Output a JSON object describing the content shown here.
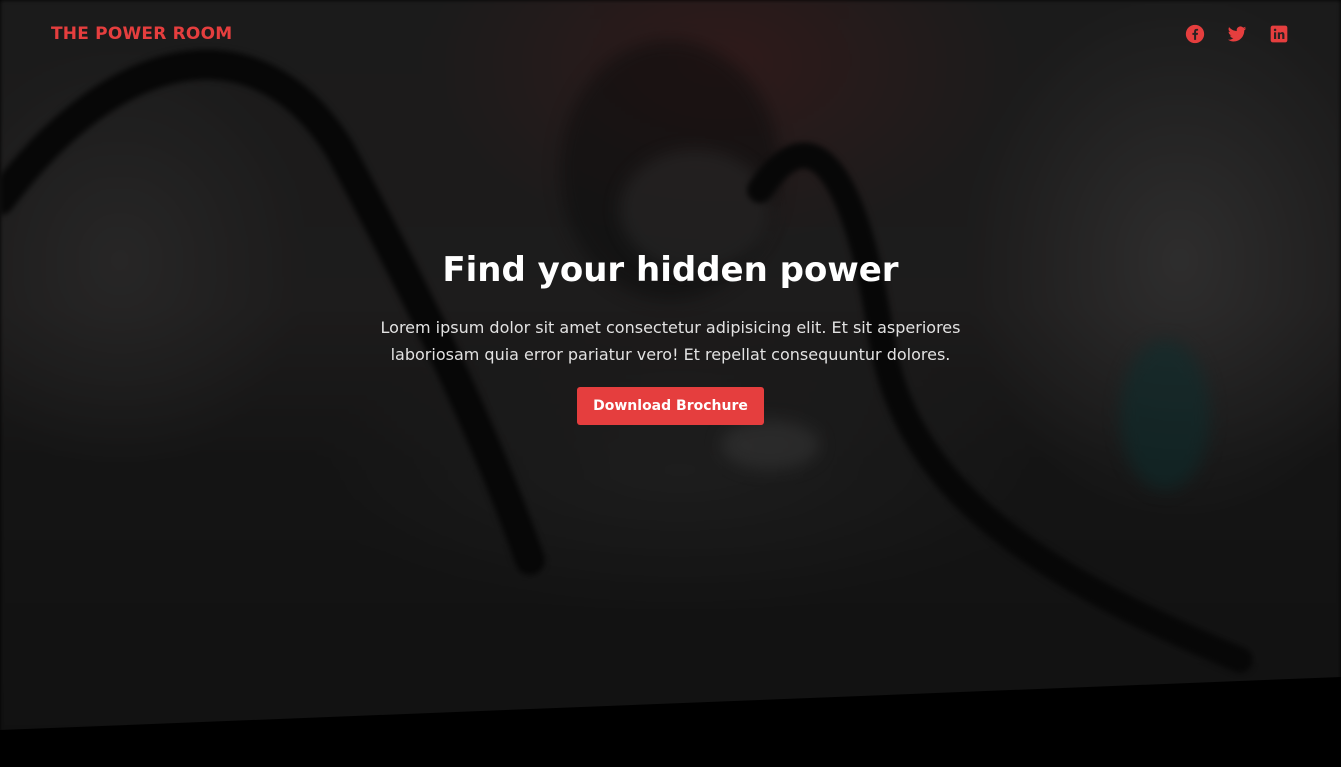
{
  "brand": {
    "name": "THE POWER ROOM"
  },
  "colors": {
    "accent": "#e53e3e",
    "headline": "#ffffff",
    "body": "#e2e2e2"
  },
  "social": [
    {
      "name": "facebook",
      "icon": "facebook-icon"
    },
    {
      "name": "twitter",
      "icon": "twitter-icon"
    },
    {
      "name": "linkedin",
      "icon": "linkedin-icon"
    }
  ],
  "hero": {
    "title": "Find your hidden power",
    "description": "Lorem ipsum dolor sit amet consectetur adipisicing elit. Et sit asperiores laboriosam quia error pariatur vero! Et repellat consequuntur dolores.",
    "cta_label": "Download Brochure"
  }
}
